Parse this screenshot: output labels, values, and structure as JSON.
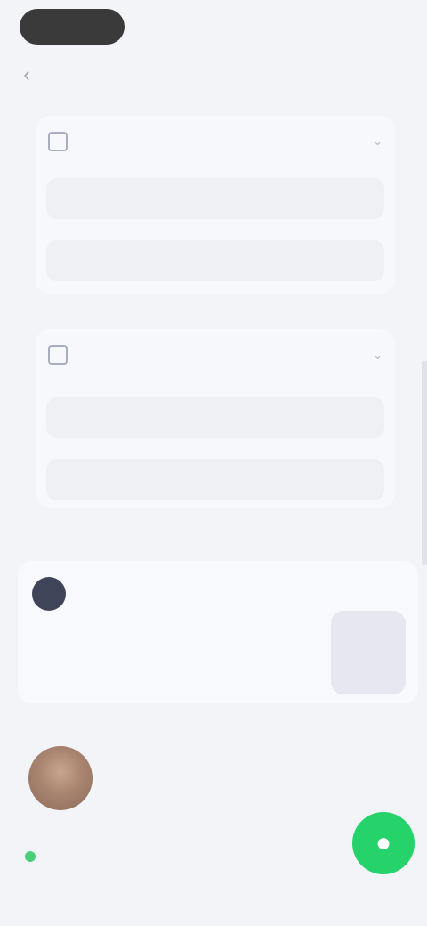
{
  "header": {
    "title": ""
  },
  "cards": [
    {
      "title": "",
      "options": [
        "",
        ""
      ]
    },
    {
      "title": "",
      "options": [
        "",
        ""
      ]
    }
  ],
  "feed": {
    "item1": {
      "author": "",
      "line1": "",
      "line2": ""
    },
    "item2": {
      "author": "",
      "text": ""
    }
  },
  "colors": {
    "fab": "#26d36b",
    "dark_pill": "#3a3a3a",
    "background": "#f3f4f8"
  },
  "icons": {
    "back": "arrow-left",
    "chevron": "chevron-down",
    "fab": "chat"
  }
}
